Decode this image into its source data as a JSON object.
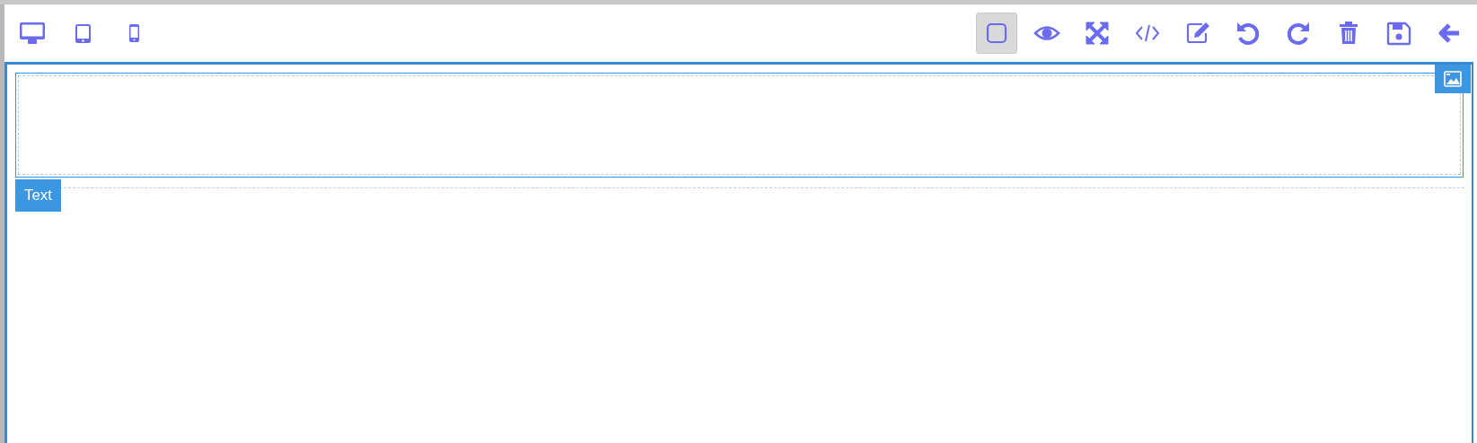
{
  "devices": [
    {
      "kind": "desktop"
    },
    {
      "kind": "tablet"
    },
    {
      "kind": "mobile"
    }
  ],
  "commands": [
    {
      "kind": "outline",
      "on": true
    },
    {
      "kind": "preview",
      "on": false
    },
    {
      "kind": "fullscreen",
      "on": false
    },
    {
      "kind": "code",
      "on": false
    },
    {
      "kind": "edit",
      "on": false
    },
    {
      "kind": "undo",
      "on": false
    },
    {
      "kind": "redo",
      "on": false
    },
    {
      "kind": "delete",
      "on": false
    },
    {
      "kind": "save",
      "on": false
    },
    {
      "kind": "back",
      "on": false
    }
  ],
  "canvas": {
    "label": "Text"
  }
}
